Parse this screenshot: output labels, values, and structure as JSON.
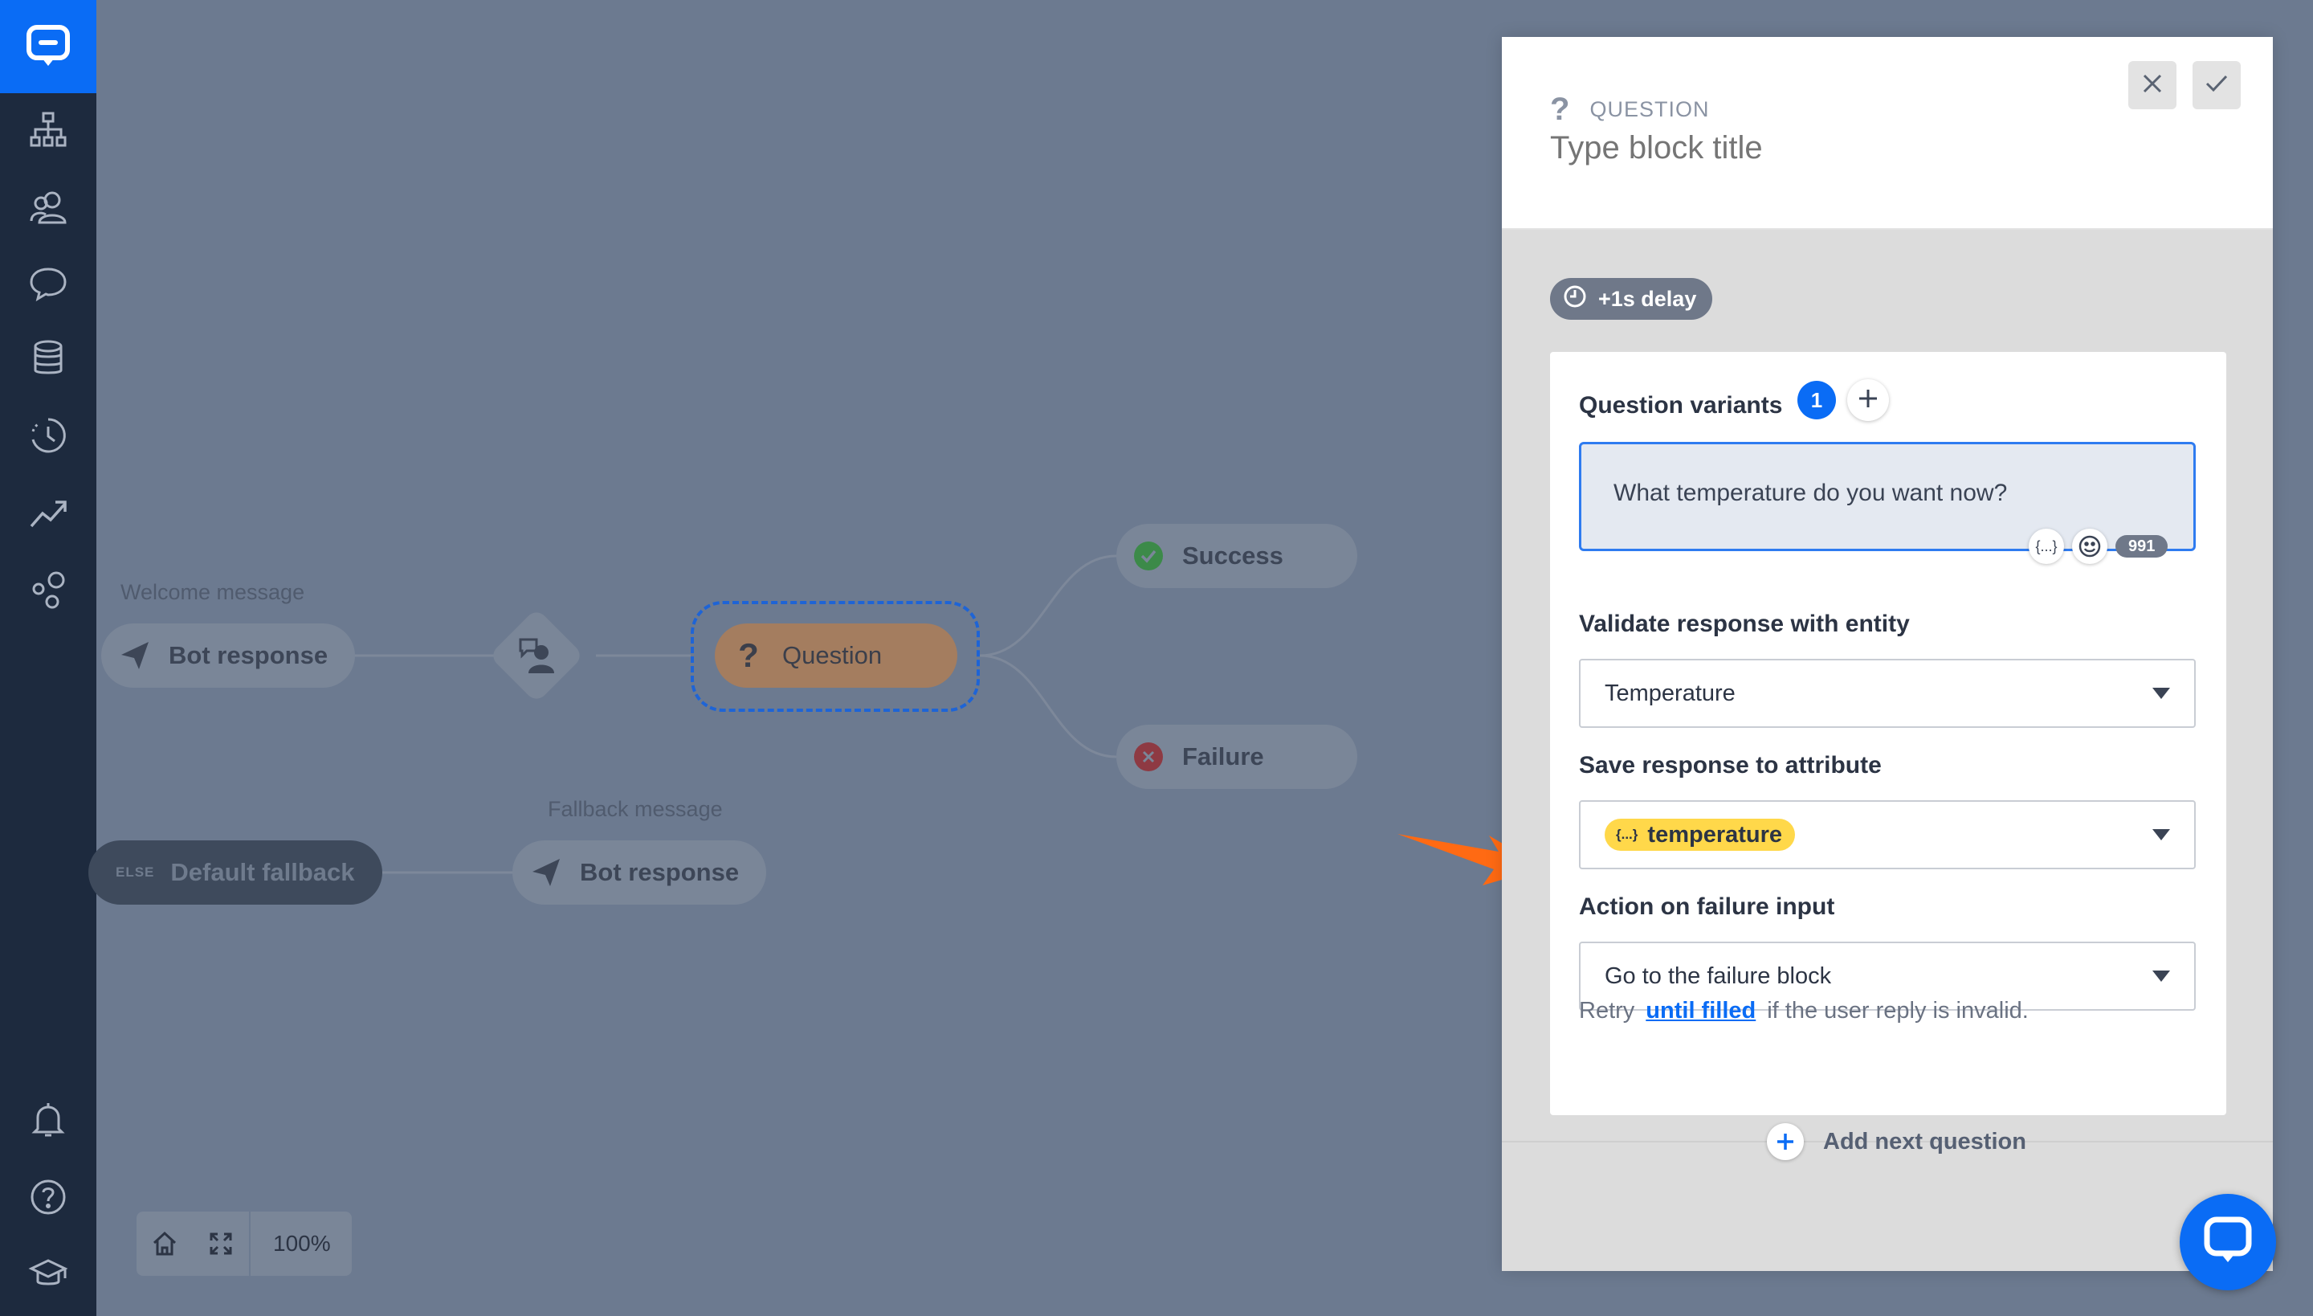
{
  "sidebar": {
    "icons": [
      "chat-logo-icon",
      "flow-icon",
      "users-icon",
      "chat-bubble-icon",
      "database-icon",
      "history-icon",
      "analytics-icon",
      "integrations-icon",
      "bell-icon",
      "help-icon",
      "academy-icon"
    ]
  },
  "canvas": {
    "welcome_label": "Welcome message",
    "welcome_node": "Bot response",
    "question_node": "Question",
    "success_node": "Success",
    "failure_node": "Failure",
    "fallback_else": "ELSE",
    "fallback_node": "Default fallback",
    "fallback_label": "Fallback message",
    "fallback_response": "Bot response",
    "zoom": "100%"
  },
  "panel": {
    "type_label": "QUESTION",
    "title_placeholder": "Type block title",
    "delay": "+1s delay",
    "variants_label": "Question variants",
    "variants_count": "1",
    "question_text": "What temperature do you want now?",
    "vars_button": "{...}",
    "char_count": "991",
    "validate_label": "Validate response with entity",
    "validate_value": "Temperature",
    "save_label": "Save response to attribute",
    "attribute_value": "temperature",
    "attribute_icon": "{...}",
    "failure_label": "Action on failure input",
    "failure_value": "Go to the failure block",
    "retry_prefix": "Retry",
    "retry_link": "until filled",
    "retry_suffix": "if the user reply is invalid.",
    "add_next": "Add next question"
  },
  "colors": {
    "accent": "#0a6cf5",
    "sidebar": "#1d2a3e",
    "overlay": "#6c7a90",
    "arrow": "#ff6a13",
    "attribute_chip": "#ffd84a"
  }
}
